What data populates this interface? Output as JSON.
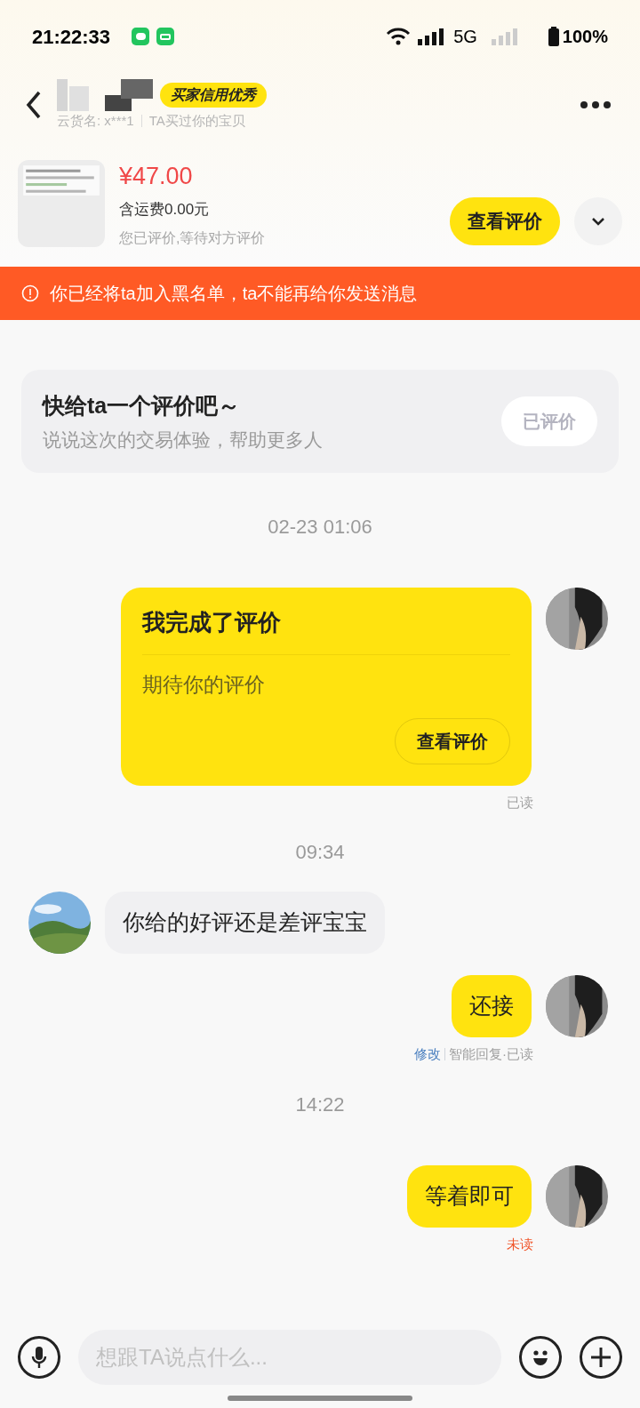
{
  "status_bar": {
    "time": "21:22:33",
    "network": "5G",
    "battery": "100%"
  },
  "header": {
    "badge": "买家信用优秀",
    "subtitle_prefix": "云货名: x***1",
    "subtitle": "TA买过你的宝贝"
  },
  "product": {
    "price": "¥47.00",
    "shipping": "含运费0.00元",
    "status": "您已评价,等待对方评价",
    "button": "查看评价"
  },
  "banner": {
    "text": "你已经将ta加入黑名单，ta不能再给你发送消息"
  },
  "review_prompt": {
    "title": "快给ta一个评价吧～",
    "subtitle": "说说这次的交易体验，帮助更多人",
    "button": "已评价",
    "disabled": true
  },
  "messages": [
    {
      "kind": "time",
      "text": "02-23 01:06"
    },
    {
      "kind": "card",
      "outgoing": true,
      "title": "我完成了评价",
      "body": "期待你的评价",
      "button": "查看评价",
      "receipt": "已读",
      "read": true
    },
    {
      "kind": "time",
      "text": "09:34"
    },
    {
      "kind": "text",
      "outgoing": false,
      "text": "你给的好评还是差评宝宝"
    },
    {
      "kind": "text",
      "outgoing": true,
      "text": "还接",
      "edit": "修改",
      "receipt": "智能回复·已读",
      "read": true
    },
    {
      "kind": "time",
      "text": "14:22"
    },
    {
      "kind": "text",
      "outgoing": true,
      "text": "等着即可",
      "receipt": "未读",
      "read": false
    }
  ],
  "input": {
    "placeholder": "想跟TA说点什么..."
  }
}
